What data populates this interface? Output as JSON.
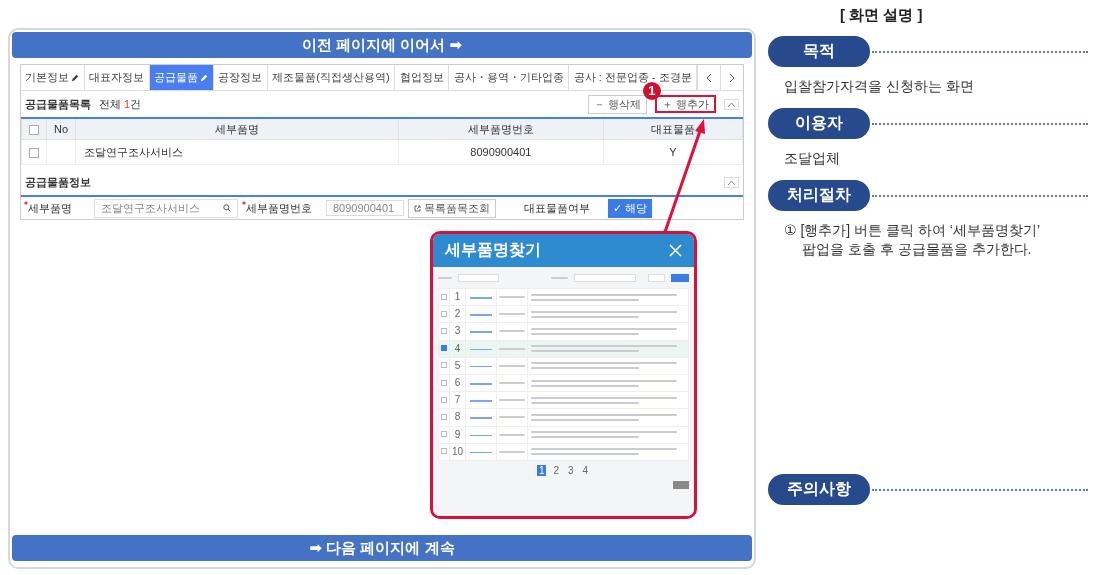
{
  "continue_top": "이전 페이지에 이어서 ➡",
  "app": {
    "tabs": [
      {
        "label": "기본정보",
        "selected": false,
        "edit": true
      },
      {
        "label": "대표자정보",
        "selected": false,
        "edit": false
      },
      {
        "label": "공급물품",
        "selected": true,
        "edit": true
      },
      {
        "label": "공장정보",
        "selected": false,
        "edit": false
      },
      {
        "label": "제조물품(직접생산용역)",
        "selected": false,
        "edit": false
      },
      {
        "label": "협업정보",
        "selected": false,
        "edit": false
      },
      {
        "label": "공사・용역・기타업종",
        "selected": false,
        "edit": false
      },
      {
        "label": "공사 : 전문업종 - 조경분",
        "selected": false,
        "edit": false
      }
    ],
    "list": {
      "title": "공급물품목록",
      "count_label": "전체",
      "count": "1",
      "count_unit": "건",
      "all_checked": false,
      "buttons": [
        {
          "label": "－ 행삭제",
          "highlighted": false
        },
        {
          "label": "＋ 행추가",
          "highlighted": true
        }
      ],
      "columns": [
        "No",
        "세부품명",
        "세부품명번호",
        "대표물품"
      ],
      "rows": [
        {
          "checked": false,
          "name": "조달연구조사서비스",
          "code": "8090900401",
          "rep": "Y"
        }
      ]
    },
    "info": {
      "title": "공급물품정보",
      "name_label": "세부품명",
      "name_value": "조달연구조사서비스",
      "code_label": "세부품명번호",
      "code_value": "8090900401",
      "lookup_button": "목록품목조회",
      "rep_label": "대표물품여부",
      "rep_button": "✓ 해당",
      "rep_checked": true
    }
  },
  "step_badge": "1",
  "popup": {
    "title": "세부품명찾기",
    "rows": [
      {
        "no": "1",
        "checked": false
      },
      {
        "no": "2",
        "checked": false
      },
      {
        "no": "3",
        "checked": false
      },
      {
        "no": "4",
        "checked": true
      },
      {
        "no": "5",
        "checked": false
      },
      {
        "no": "6",
        "checked": false
      },
      {
        "no": "7",
        "checked": false
      },
      {
        "no": "8",
        "checked": false
      },
      {
        "no": "9",
        "checked": false
      },
      {
        "no": "10",
        "checked": false
      }
    ],
    "pages": [
      {
        "label": "1",
        "selected": true
      },
      {
        "label": "2",
        "selected": false
      },
      {
        "label": "3",
        "selected": false
      },
      {
        "label": "4",
        "selected": false
      }
    ]
  },
  "continue_bottom": "➡ 다음 페이지에 계속",
  "notes": {
    "title": "[ 화면 설명 ]",
    "sections": [
      {
        "heading": "목적",
        "lines": [
          "입찰참가자격을 신청하는 화면"
        ]
      },
      {
        "heading": "이용자",
        "lines": [
          "조달업체"
        ]
      },
      {
        "heading": "처리절차",
        "lines": [
          "① [행추가] 버튼 클릭 하여 ‘세부품명찾기’",
          "팝업을 호출 후 공급물품을 추가한다."
        ]
      },
      {
        "heading": "주의사항"
      }
    ]
  }
}
